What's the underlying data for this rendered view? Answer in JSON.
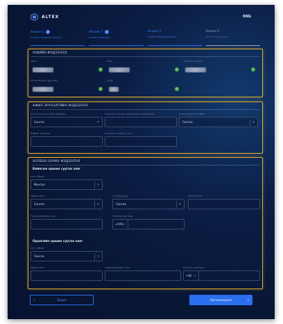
{
  "header": {
    "logo_text": "ALTEX",
    "lang": "ENG"
  },
  "steps": [
    {
      "title": "Алхам 1",
      "subtitle": "Хувийн мэдээлэл шалгах",
      "done": true,
      "active": true
    },
    {
      "title": "Алхам 2",
      "subtitle": "Ажлын мэдээлэл",
      "done": true,
      "active": true
    },
    {
      "title": "Алхам 3",
      "subtitle": "Холбоо барих мэдээлэл",
      "done": false,
      "active": true
    },
    {
      "title": "Алхам 4",
      "subtitle": "Баталгаажуулалт",
      "done": false,
      "active": false
    }
  ],
  "personal": {
    "title": "ХУВИЙН МЭДЭЭЛЭЛ",
    "last_name_label": "Овог",
    "first_name_label": "Нэр",
    "birth_date_label": "Төрсөн огноо",
    "register_label": "Регистрийн дугаар",
    "gender_label": "Хүйс"
  },
  "work": {
    "title": "АЖИЛ ЭРХЛЭЛТИЙН МЭДЭЭЛЭЛ",
    "status_label": "Ажил эрхлэлтийн байдал",
    "status_value": "Сонгох",
    "company_label": "Ажлын газрын нэр (эсвэл хувиараа)",
    "position_label": "Ажилладаг салбар",
    "position_value": "Сонгох",
    "job_title_label": "Албан тушаал",
    "work_phone_label": "Ажлын газрын утас"
  },
  "contact": {
    "title": "ХОЛБОО БАРИХ МЭДЭЭЛЭЛ",
    "registered_title": "Байнгын оршин суугаа хаяг",
    "city_label": "Хот аймаг",
    "city_value": "Монгол",
    "district_label": "Аймаг/Хот",
    "district_value": "Сонгох",
    "khoroo_label": "Сум/Дүүрэг",
    "khoroo_value": "Сонгох",
    "address_label": "Хот/Хороо",
    "street_label": "Гудамж/Байр тоот",
    "phone_label": "Утасны дугаар",
    "phone_code": "+976",
    "current_title": "Одоогийн оршин суугаа хаяг",
    "cur_city_label": "Хот аймаг",
    "cur_city_value": "Сонгох",
    "cur_district_label": "Аймаг/Хот",
    "cur_street_label": "Гудамж/Байр тоот",
    "cur_phone_label": "Утасны дугаар",
    "cur_phone_code": "+82"
  },
  "buttons": {
    "back": "Буцах",
    "next": "Үргэлжлүүлэх"
  },
  "colors": {
    "accent": "#2a6ff0",
    "highlight": "#e8b02c",
    "success": "#4caf50"
  }
}
